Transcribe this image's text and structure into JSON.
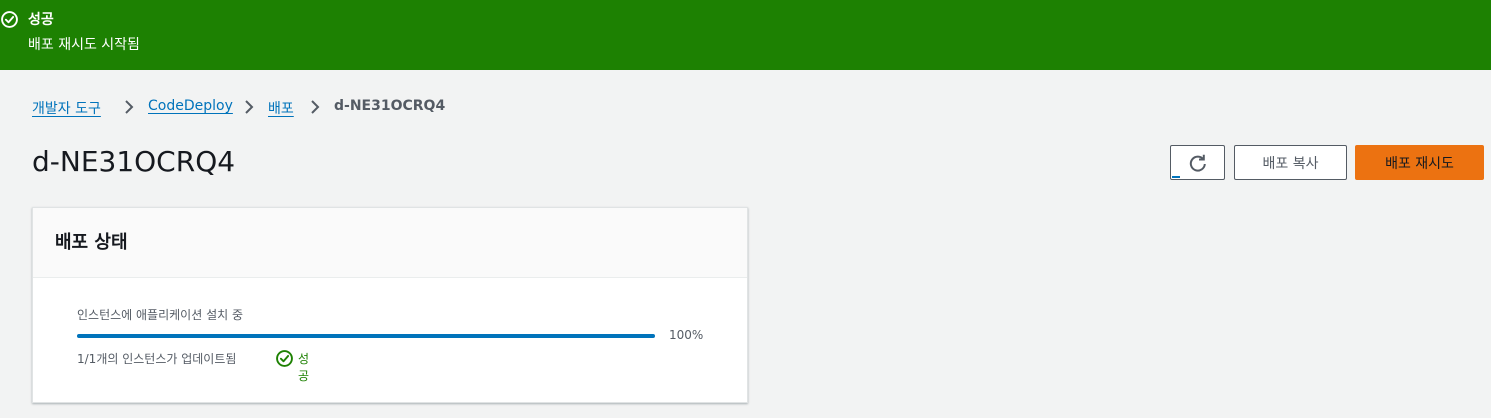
{
  "flash": {
    "icon": "check-circle-icon",
    "header": "성공",
    "content": "배포 재시도 시작됨",
    "background_color": "#1d8102"
  },
  "breadcrumb": {
    "items": [
      "개발자 도구",
      "CodeDeploy",
      "배포"
    ],
    "current": "d-NE31OCRQ4",
    "separator_icon": "chevron-right-icon"
  },
  "page": {
    "title": "d-NE31OCRQ4"
  },
  "actions": {
    "refresh_icon": "refresh-icon",
    "copy_label": "배포 복사",
    "retry_label": "배포 재시도",
    "primary_color": "#ec7211"
  },
  "deployment_status": {
    "title": "배포 상태",
    "progress_label": "인스턴스에 애플리케이션 설치 중",
    "progress_percent": 100,
    "progress_text": "100%",
    "instances_text": "1/1개의 인스턴스가 업데이트됨",
    "status_text": "성공",
    "status_icon": "check-circle-icon",
    "progress_color": "#0073bb",
    "success_color": "#1d8102"
  }
}
